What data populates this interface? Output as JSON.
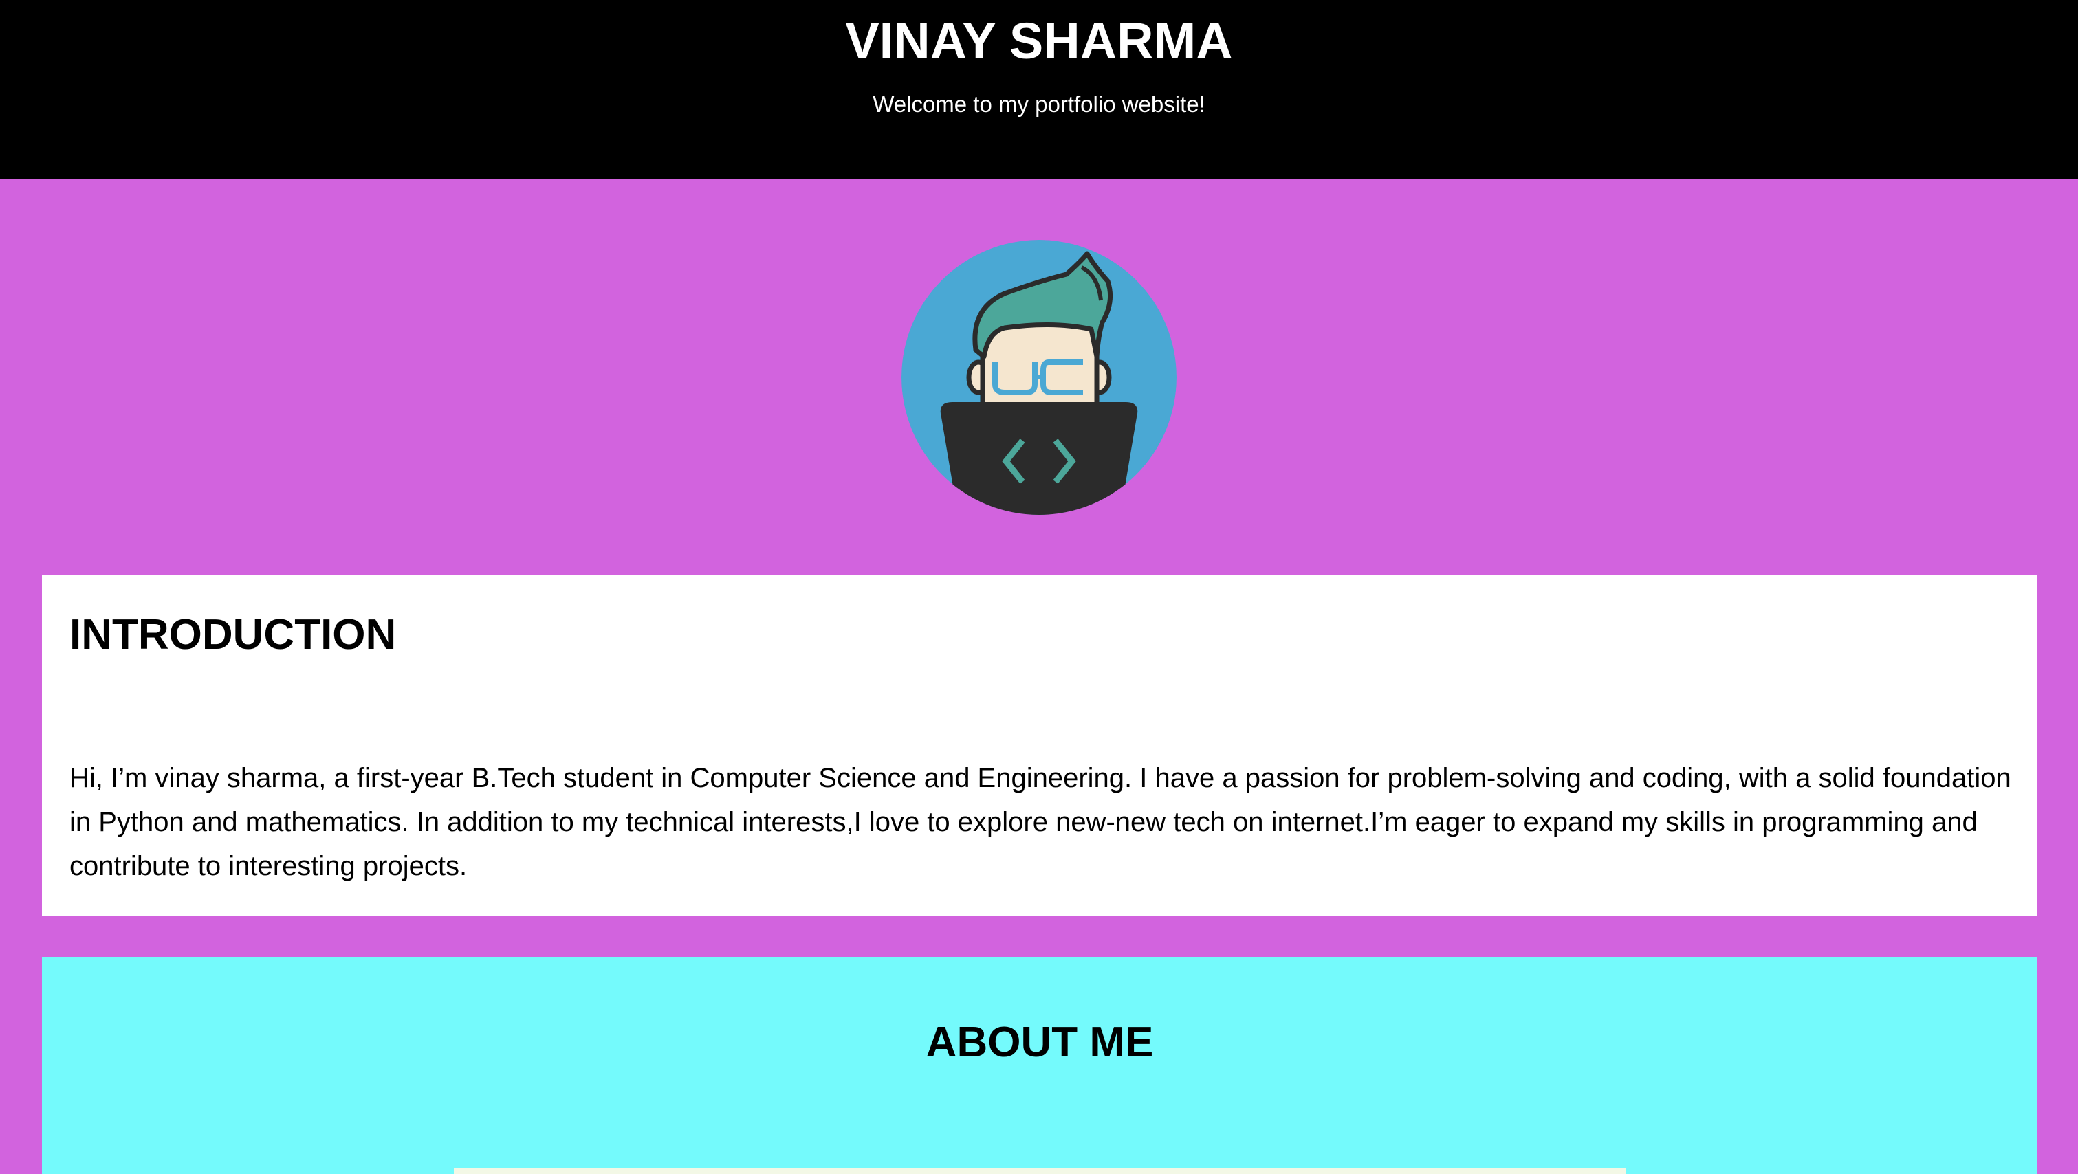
{
  "header": {
    "title": "VINAY SHARMA",
    "tagline": "Welcome to my portfolio website!"
  },
  "avatar": {
    "icon": "developer-avatar-icon"
  },
  "introduction": {
    "heading": "INTRODUCTION",
    "text": "Hi, I’m vinay sharma, a first-year B.Tech student in Computer Science and Engineering. I have a passion for problem-solving and coding, with a solid foundation in Python and mathematics. In addition to my technical interests,I love to explore new-new tech on internet.I’m eager to expand my skills in programming and contribute to interesting projects."
  },
  "about": {
    "heading": "ABOUT ME"
  },
  "colors": {
    "page_background": "#d263de",
    "header_background": "#000000",
    "intro_background": "#ffffff",
    "about_background": "#74fafc",
    "about_card_background": "#f3f8e6"
  }
}
